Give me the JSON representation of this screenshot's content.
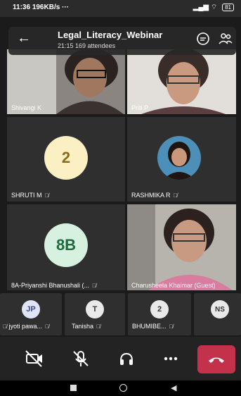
{
  "status": {
    "time": "11:36",
    "speed": "196KB/s",
    "dots": "···",
    "battery": "81"
  },
  "header": {
    "title": "Legal_Literacy_Webinar",
    "subtitle": "21:15  169 attendees"
  },
  "tiles": {
    "shivangi": "Shivangi K",
    "priti": "Priti P",
    "shruti": {
      "avatar": "2",
      "name": "SHRUTI M"
    },
    "rashmika": "RASHMIKA R",
    "priyanshi": {
      "avatar": "8B",
      "name": "8A-Priyanshi Bhanushali (..."
    },
    "charusheela": "Charusheela Khaimar (Guest)"
  },
  "small": [
    {
      "avatar": "JP",
      "name": "jyoti pawa..."
    },
    {
      "avatar": "T",
      "name": "Tanisha"
    },
    {
      "avatar": "2",
      "name": "BHUMIBE..."
    },
    {
      "avatar": "NS",
      "name": ""
    }
  ],
  "colors": {
    "accent_red": "#c4314b",
    "avatar_yellow": "#fbefc4",
    "avatar_green": "#d7f1e0",
    "avatar_blue": "#dfe4f6"
  },
  "icons": [
    "back-arrow-icon",
    "chat-icon",
    "participants-icon",
    "camera-off-icon",
    "mic-off-icon",
    "speaker-icon",
    "more-icon",
    "hangup-icon"
  ]
}
